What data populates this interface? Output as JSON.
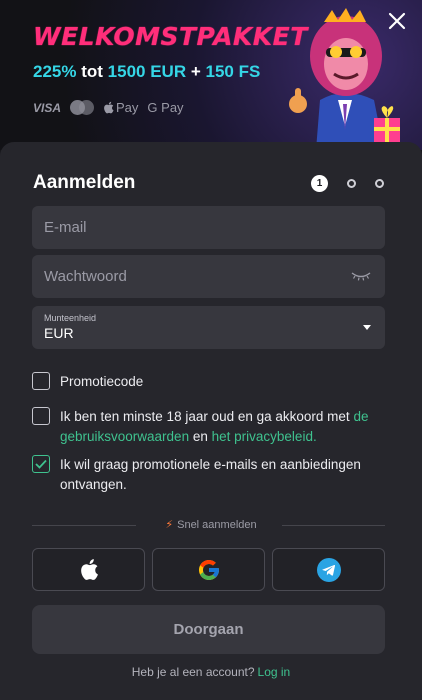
{
  "banner": {
    "title": "WELKOMSTPAKKET",
    "bonus_percent": "225%",
    "bonus_tot": "tot",
    "bonus_amount": "1500 EUR",
    "bonus_plus": "+",
    "bonus_spins": "150 FS",
    "payments": {
      "visa": "VISA",
      "apple_pay": "Pay",
      "google_pay": "G Pay"
    }
  },
  "form": {
    "title": "Aanmelden",
    "step_current": "1",
    "email_placeholder": "E-mail",
    "password_placeholder": "Wachtwoord",
    "currency_label": "Munteenheid",
    "currency_value": "EUR",
    "promo_label": "Promotiecode",
    "terms_text_1": "Ik ben ten minste 18 jaar oud en ga akkoord met",
    "terms_link_1": "de gebruiksvoorwaarden",
    "terms_text_2": "en",
    "terms_link_2": "het privacybeleid.",
    "marketing_text": "Ik wil graag promotionele e-mails en aanbiedingen ontvangen.",
    "quick_label": "Snel aanmelden",
    "submit_label": "Doorgaan",
    "footer_text": "Heb je al een account?",
    "login_link": "Log in"
  },
  "colors": {
    "accent_green": "#3fc28f",
    "banner_pink": "#ff2e7a",
    "banner_cyan": "#35d6e6"
  },
  "icons": {
    "close": "close-icon",
    "eye": "eye-closed-icon",
    "apple": "apple-icon",
    "google": "google-icon",
    "telegram": "telegram-icon",
    "bolt": "lightning-icon",
    "mascot": "lion-mascot"
  }
}
